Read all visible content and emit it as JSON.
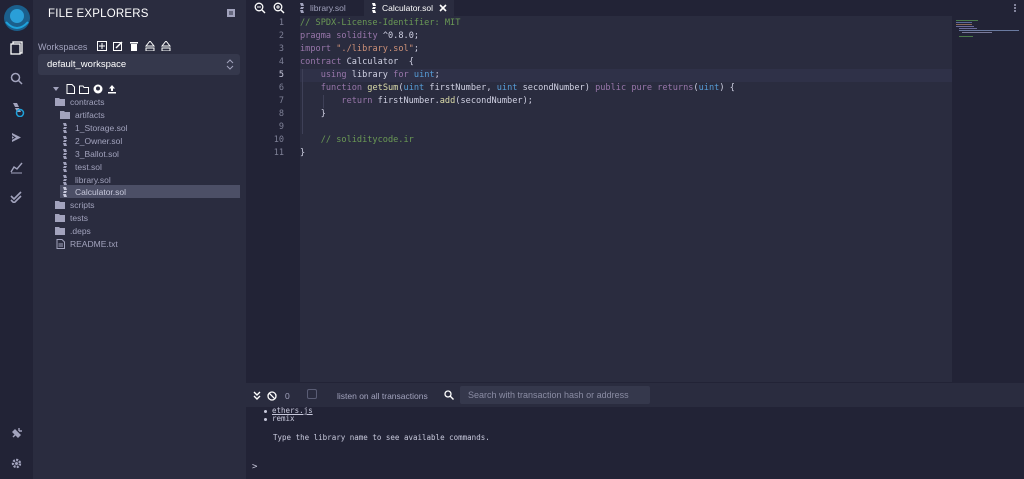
{
  "explorer": {
    "title": "FILE EXPLORERS",
    "workspaces_label": "Workspaces",
    "workspace_selected": "default_workspace",
    "tree": [
      {
        "label": "contracts",
        "type": "folder-open"
      },
      {
        "label": "artifacts",
        "type": "folder"
      },
      {
        "label": "1_Storage.sol",
        "type": "sol"
      },
      {
        "label": "2_Owner.sol",
        "type": "sol"
      },
      {
        "label": "3_Ballot.sol",
        "type": "sol"
      },
      {
        "label": "test.sol",
        "type": "sol"
      },
      {
        "label": "library.sol",
        "type": "sol"
      },
      {
        "label": "Calculator.sol",
        "type": "sol"
      },
      {
        "label": "scripts",
        "type": "folder"
      },
      {
        "label": "tests",
        "type": "folder"
      },
      {
        "label": ".deps",
        "type": "folder"
      },
      {
        "label": "README.txt",
        "type": "file"
      }
    ]
  },
  "tabs": [
    {
      "label": "library.sol",
      "active": false
    },
    {
      "label": "Calculator.sol",
      "active": true
    }
  ],
  "editor": {
    "current_line": 5,
    "lines": [
      "// SPDX-License-Identifier: MIT",
      "pragma solidity ^0.8.0;",
      "import \"./library.sol\";",
      "contract Calculator  {",
      "    using library for uint;",
      "    function getSum(uint firstNumber, uint secondNumber) public pure returns(uint) {",
      "        return firstNumber.add(secondNumber);",
      "    }",
      "",
      "    // soliditycode.ir",
      "}"
    ]
  },
  "terminal": {
    "pending_count": "0",
    "listen_label": "listen on all transactions",
    "search_placeholder": "Search with transaction hash or address",
    "items": [
      "ethers.js",
      "remix"
    ],
    "hint": "Type the library name to see available commands.",
    "prompt": ">"
  },
  "colors": {
    "bg": "#222336",
    "panel": "#2a2c3f",
    "accent": "#1ea2dc"
  }
}
